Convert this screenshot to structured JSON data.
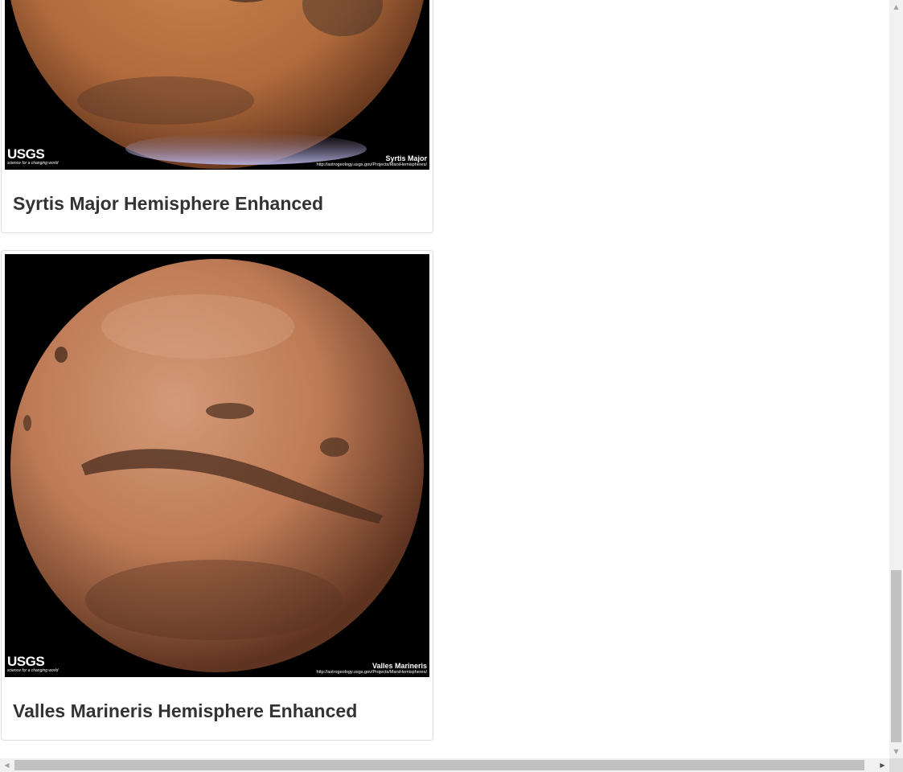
{
  "hemispheres": [
    {
      "title": "Syrtis Major Hemisphere Enhanced",
      "image_logo": "USGS",
      "image_tagline": "science for a changing world",
      "image_caption": "Syrtis Major",
      "image_url_text": "http://astrogeology.usgs.gov/Projects/MarsHemispheres/"
    },
    {
      "title": "Valles Marineris Hemisphere Enhanced",
      "image_logo": "USGS",
      "image_tagline": "science for a changing world",
      "image_caption": "Valles Marineris",
      "image_url_text": "http://astrogeology.usgs.gov/Projects/MarsHemispheres/"
    }
  ],
  "scrollbars": {
    "vertical": {
      "up_icon": "triangle-up-icon",
      "down_icon": "triangle-down-icon",
      "position_fraction": 0.78
    },
    "horizontal": {
      "left_icon": "triangle-left-icon",
      "right_icon": "triangle-right-icon",
      "position_fraction": 0.0
    }
  },
  "colors": {
    "title_text": "#333333",
    "card_border": "#dddddd",
    "mars_orange": "#c07848"
  }
}
